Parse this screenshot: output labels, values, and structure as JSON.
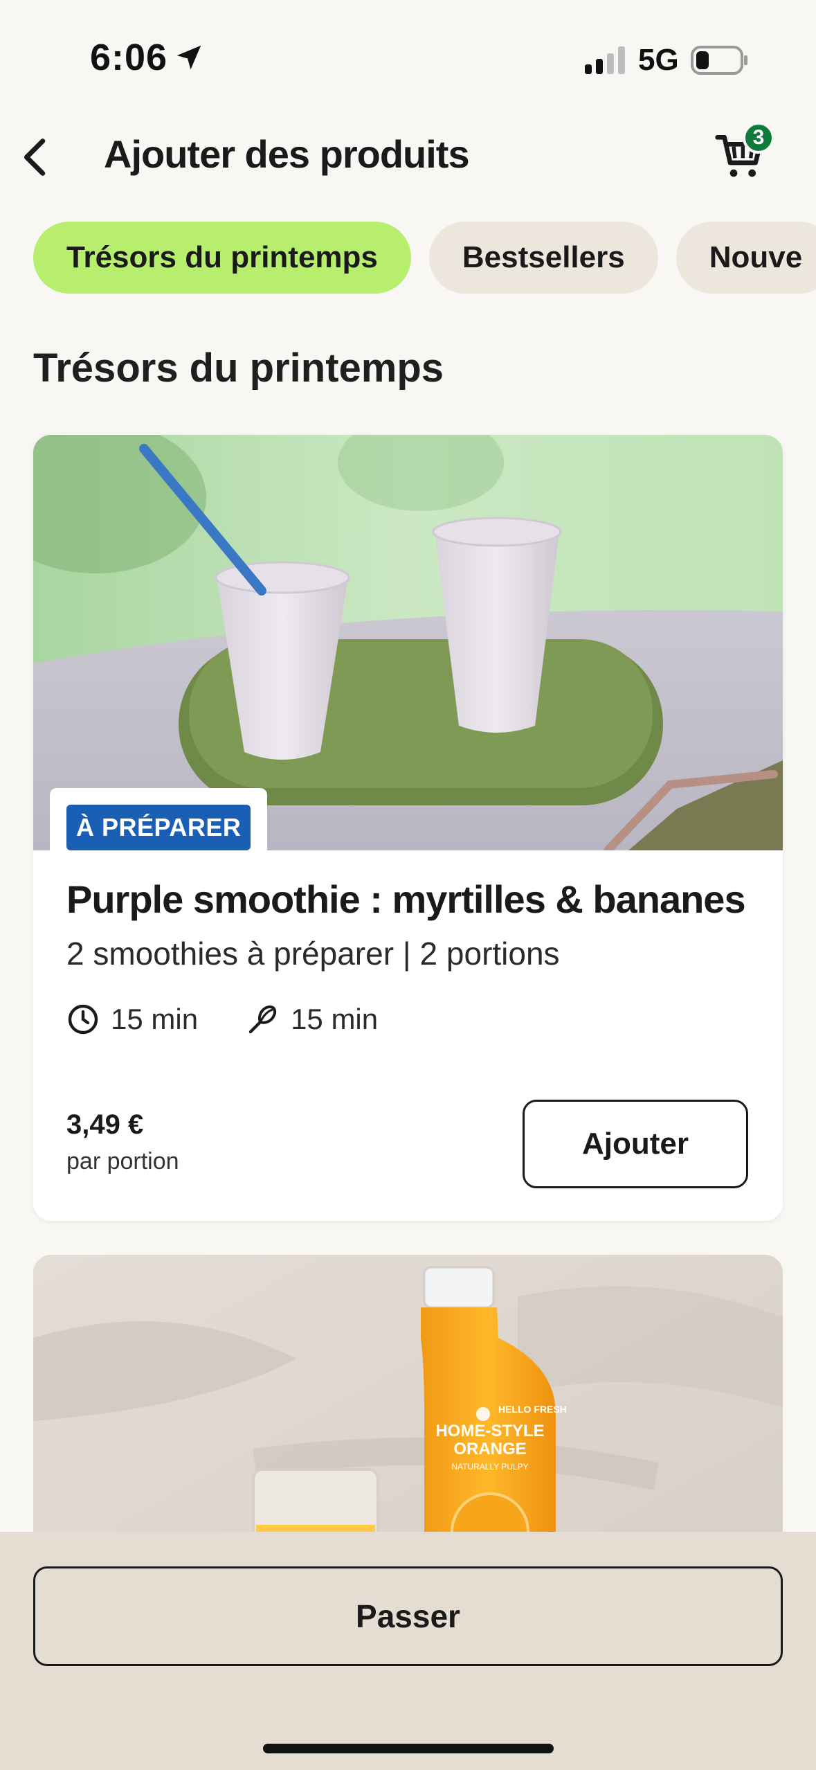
{
  "status_bar": {
    "time": "6:06",
    "network": "5G"
  },
  "header": {
    "title": "Ajouter des produits",
    "cart_count": "3"
  },
  "tabs": [
    {
      "label": "Trésors du printemps",
      "active": true
    },
    {
      "label": "Bestsellers",
      "active": false
    },
    {
      "label": "Nouve",
      "active": false
    }
  ],
  "section": {
    "title": "Trésors du printemps"
  },
  "product": {
    "tag": "À PRÉPARER",
    "name": "Purple smoothie : myrtilles & bananes",
    "subtitle": "2 smoothies à préparer | 2 portions",
    "total_time": "15 min",
    "prep_time": "15 min",
    "price": "3,49 €",
    "price_unit": "par portion",
    "add_label": "Ajouter"
  },
  "product2": {
    "bottle_text": [
      "HELLO FRESH",
      "HOME-STYLE",
      "ORANGE",
      "NATURALLY PULPY"
    ]
  },
  "footer": {
    "skip_label": "Passer"
  },
  "colors": {
    "accent_active_tab": "#b8ee6e",
    "tag_blue": "#1a5fb4",
    "badge_green": "#0e7a3c",
    "bottom_bar": "#e5ddd2",
    "page_bg": "#f8f7f3"
  }
}
